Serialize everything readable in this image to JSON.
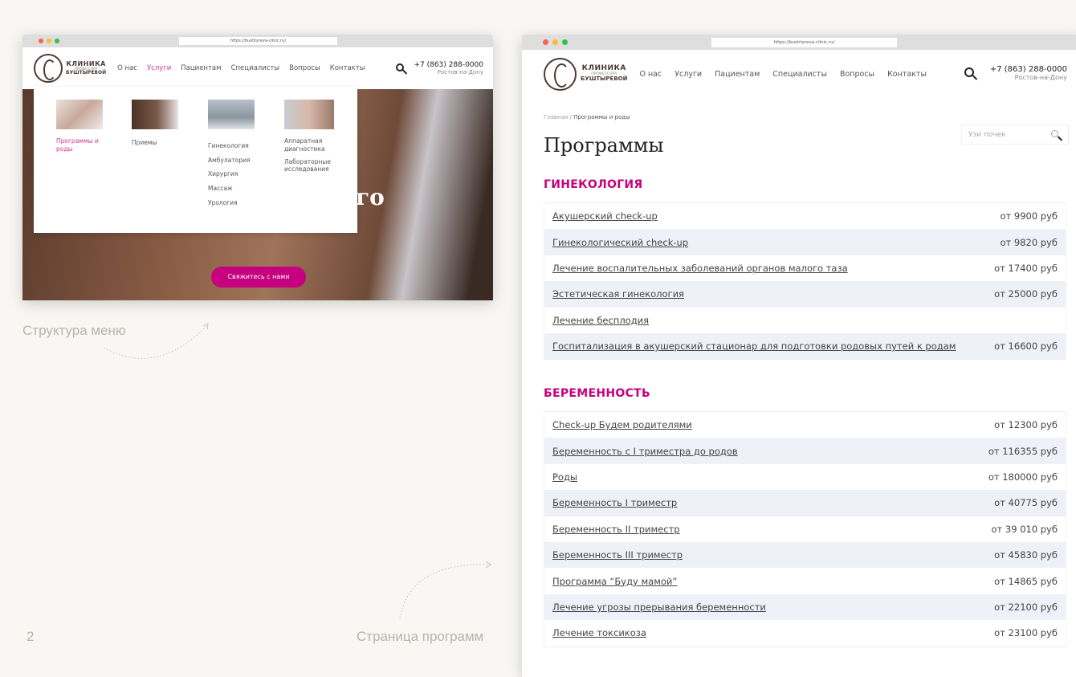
{
  "browser": {
    "url": "https://bushtyreva-clinic.ru/"
  },
  "logo": {
    "line1": "КЛИНИКА",
    "line2": "ПРОФЕССОРА",
    "line3": "БУШТЫРЕВОЙ"
  },
  "nav": [
    "О нас",
    "Услуги",
    "Пациентам",
    "Специалисты",
    "Вопросы",
    "Контакты"
  ],
  "contact": {
    "phone": "+7 (863) 288-0000",
    "city": "Ростов-на-Дону"
  },
  "menu": {
    "columns": [
      {
        "title": "Программы и роды",
        "items": []
      },
      {
        "title": "Приемы",
        "items": []
      },
      {
        "title": "",
        "items": [
          "Гинекология",
          "Амбулатория",
          "Хирургия",
          "Массаж",
          "Урология"
        ]
      },
      {
        "title": "",
        "items": [
          "Аппаратная диагностика",
          "Лабораторные исследования"
        ]
      }
    ]
  },
  "hero": {
    "title_fragment": "го",
    "cta": "Свяжитесь с нами"
  },
  "captions": {
    "menu": "Структура меню",
    "programs": "Страница программ",
    "page_number": "2"
  },
  "page": {
    "breadcrumb_home": "Главная",
    "breadcrumb_current": "Программы и роды",
    "title": "Программы",
    "search_value": "Узи почек",
    "sections": [
      {
        "heading": "ГИНЕКОЛОГИЯ",
        "rows": [
          {
            "name": "Акушерский check-up",
            "price": "от 9900 руб"
          },
          {
            "name": "Гинекологический check-up",
            "price": "от 9820 руб"
          },
          {
            "name": "Лечение воспалительных заболеваний органов малого таза",
            "price": "от 17400 руб"
          },
          {
            "name": "Эстетическая гинекология",
            "price": "от 25000 руб"
          },
          {
            "name": "Лечение бесплодия",
            "price": ""
          },
          {
            "name": "Госпитализация в акушерский стационар для подготовки родовых путей к родам",
            "price": "от 16600 руб"
          }
        ]
      },
      {
        "heading": "БЕРЕМЕННОСТЬ",
        "rows": [
          {
            "name": "Check-up Будем родителями",
            "price": "от 12300 руб"
          },
          {
            "name": "Беременность с I триместра до родов",
            "price": "от 116355 руб"
          },
          {
            "name": "Роды",
            "price": "от 180000 руб"
          },
          {
            "name": "Беременность I триместр",
            "price": "от 40775 руб"
          },
          {
            "name": "Беременность II триместр",
            "price": "от 39 010 руб"
          },
          {
            "name": "Беременность III триместр",
            "price": "от 45830 руб"
          },
          {
            "name": "Программа “Буду мамой”",
            "price": "от 14865 руб"
          },
          {
            "name": "Лечение угрозы прерывания беременности",
            "price": "от 22100 руб"
          },
          {
            "name": "Лечение токсикоза",
            "price": "от 23100 руб"
          }
        ]
      }
    ]
  },
  "colors": {
    "accent": "#c6007e",
    "background": "#f8f7f3",
    "row_alt": "#eff1f9"
  }
}
